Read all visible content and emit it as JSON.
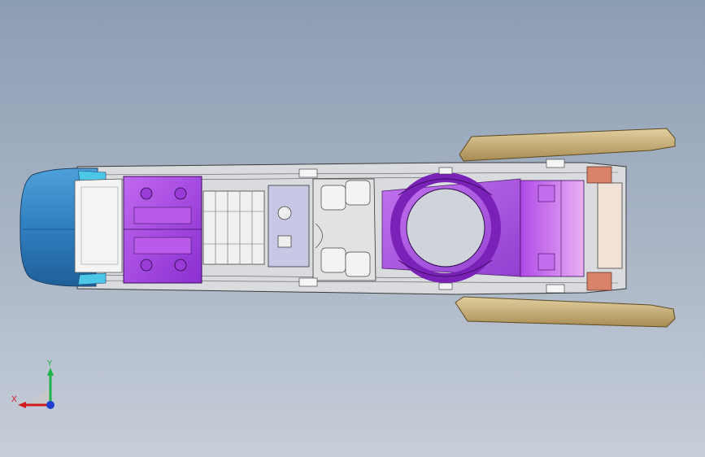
{
  "viewport": {
    "background_top": "#8c9db3",
    "background_bottom": "#c7ced9"
  },
  "model": {
    "part_colors": {
      "front_cap": "#2f7fc0",
      "rear_brackets": "#c2a86e",
      "purple_parts": "#a640e0",
      "grey_structure": "#d7d9dc",
      "hinge_parts": "#d9826a",
      "white_panels": "#f1f1f1"
    }
  },
  "triad": {
    "x_label": "X",
    "y_label": "Y",
    "x_color": "#d01c1c",
    "y_color": "#1fb24a",
    "z_color": "#1f3ed0"
  }
}
